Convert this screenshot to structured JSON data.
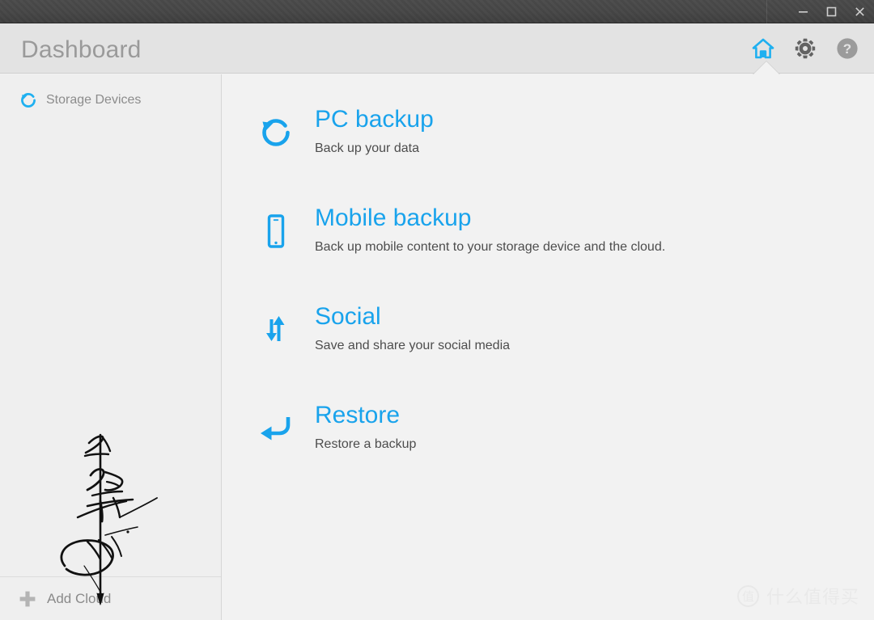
{
  "window": {
    "controls": [
      {
        "name": "minimize",
        "glyph": "minimize-icon"
      },
      {
        "name": "maximize",
        "glyph": "maximize-icon"
      },
      {
        "name": "close",
        "glyph": "close-icon"
      }
    ]
  },
  "header": {
    "title": "Dashboard",
    "icons": [
      {
        "name": "home-icon",
        "label": "Home",
        "active": true,
        "color": "#1fb0f0"
      },
      {
        "name": "gear-icon",
        "label": "Settings",
        "active": false,
        "color": "#6b6b6b"
      },
      {
        "name": "help-icon",
        "label": "Help",
        "active": false,
        "color": "#9b9b9b"
      }
    ]
  },
  "sidebar": {
    "section_label": "Storage Devices",
    "section_icon": "backup-circle-arrow-icon",
    "footer_label": "Add Cloud",
    "footer_icon": "plus-icon"
  },
  "main": {
    "actions": [
      {
        "icon": "backup-circle-arrow-icon",
        "title": "PC backup",
        "subtitle": "Back up your data"
      },
      {
        "icon": "mobile-phone-icon",
        "title": "Mobile backup",
        "subtitle": "Back up mobile content to your storage device and the cloud."
      },
      {
        "icon": "up-down-arrows-icon",
        "title": "Social",
        "subtitle": "Save and share your social media"
      },
      {
        "icon": "return-arrow-icon",
        "title": "Restore",
        "subtitle": "Restore a backup"
      }
    ]
  },
  "watermark": {
    "badge": "值",
    "text": "什么值得买"
  },
  "colors": {
    "accent": "#19a3ec",
    "accent_icon": "#1fb0f0",
    "titlebar": "#464646",
    "header_bg": "#e3e3e3",
    "sidebar_bg": "#efefef",
    "content_bg": "#f2f2f2",
    "title_text": "#9a9a9a",
    "sub_text": "#4d4d4d"
  }
}
